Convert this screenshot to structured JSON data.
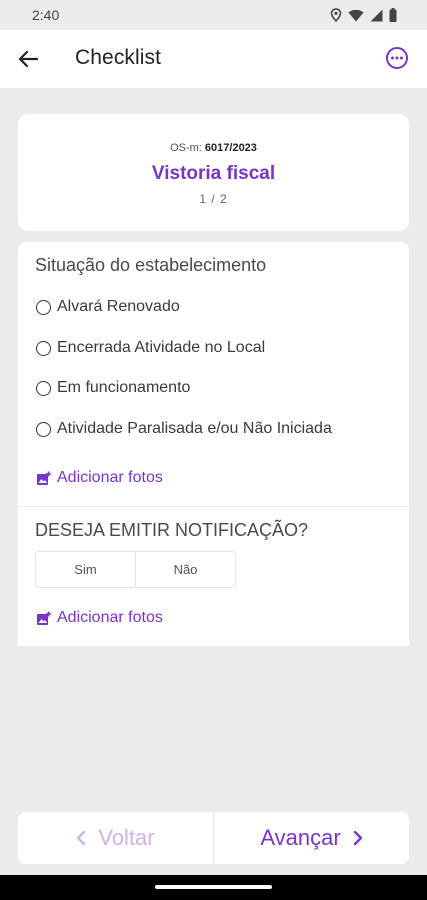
{
  "status_bar": {
    "time": "2:40"
  },
  "app_bar": {
    "title": "Checklist"
  },
  "header": {
    "os_label": "OS-m:",
    "os_number": "6017/2023",
    "visit_title": "Vistoria fiscal",
    "page_counter": "1 / 2"
  },
  "section1": {
    "title": "Situação do estabelecimento",
    "options": [
      {
        "label": "Alvará Renovado",
        "selected": false
      },
      {
        "label": "Encerrada Atividade no Local",
        "selected": false
      },
      {
        "label": "Em funcionamento",
        "selected": false
      },
      {
        "label": "Atividade Paralisada e/ou Não Iniciada",
        "selected": false
      }
    ],
    "add_photos_label": "Adicionar fotos"
  },
  "section2": {
    "title": "DESEJA EMITIR NOTIFICAÇÃO?",
    "choices": [
      "Sim",
      "Não"
    ],
    "add_photos_label": "Adicionar fotos"
  },
  "navigation": {
    "prev_label": "Voltar",
    "next_label": "Avançar",
    "prev_enabled": false
  },
  "colors": {
    "accent": "#7a35c8",
    "accent_disabled": "#c9b6e8",
    "background": "#ececec",
    "card": "#ffffff"
  }
}
